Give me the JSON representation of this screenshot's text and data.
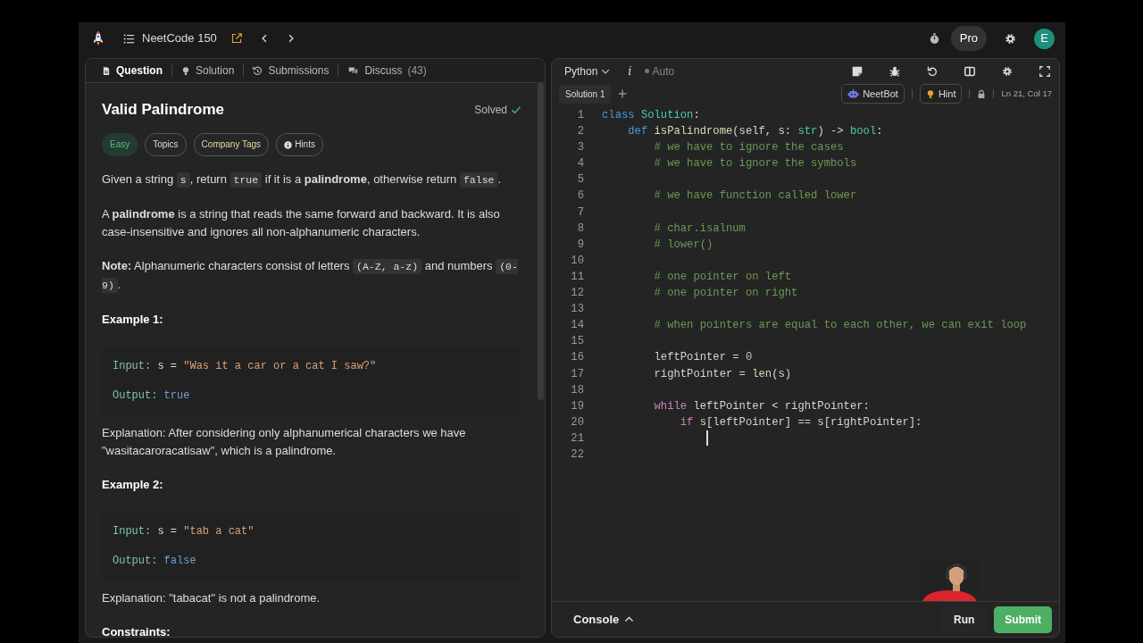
{
  "top_bar": {
    "problem_list": "NeetCode 150",
    "pro": "Pro",
    "avatar": "E"
  },
  "question_panel": {
    "tabs": [
      {
        "label": "Question",
        "selected": true
      },
      {
        "label": "Solution",
        "selected": false
      },
      {
        "label": "Submissions",
        "selected": false
      },
      {
        "label": "Discuss",
        "count": "(43)",
        "selected": false
      }
    ],
    "title": "Valid Palindrome",
    "status": "Solved",
    "tags": [
      {
        "label": "Easy",
        "kind": "difficulty"
      },
      {
        "label": "Topics",
        "kind": "plain"
      },
      {
        "label": "Company Tags",
        "kind": "company"
      },
      {
        "label": "Hints",
        "kind": "hint"
      }
    ],
    "blocks": [
      {
        "kind": "paragraph",
        "parts": [
          {
            "kind": "text",
            "text": "Given a string "
          },
          {
            "kind": "code",
            "text": "s"
          },
          {
            "kind": "text",
            "text": ", return "
          },
          {
            "kind": "code",
            "text": "true"
          },
          {
            "kind": "text",
            "text": " if it is a **palindrome**, otherwise return "
          },
          {
            "kind": "code",
            "text": "false"
          },
          {
            "kind": "text",
            "text": "."
          }
        ]
      },
      {
        "kind": "paragraph",
        "parts": [
          {
            "kind": "text",
            "text": "A **palindrome** is a string that reads the same forward and backward. It is also case-insensitive and ignores all non-alphanumeric characters."
          }
        ]
      },
      {
        "kind": "paragraph",
        "parts": [
          {
            "kind": "text",
            "text": "**Note:** Alphanumeric characters consist of letters "
          },
          {
            "kind": "code",
            "text": "(A-Z, a-z)"
          },
          {
            "kind": "text",
            "text": " and numbers "
          },
          {
            "kind": "code",
            "text": "(0-9)"
          },
          {
            "kind": "text",
            "text": "."
          }
        ]
      },
      {
        "kind": "heading",
        "text": "Example 1:"
      },
      {
        "kind": "example",
        "lines": [
          [
            {
              "kind": "label",
              "text": "Input:"
            },
            {
              "kind": "plain",
              "text": " s = "
            },
            {
              "kind": "string",
              "text": "\"Was it a car or a cat I saw?\""
            }
          ],
          [
            {
              "kind": "label",
              "text": "Output:"
            },
            {
              "kind": "value",
              "text": "true"
            }
          ]
        ]
      },
      {
        "kind": "paragraph",
        "parts": [
          {
            "kind": "text",
            "text": "Explanation: After considering only alphanumerical characters we have \"wasitacaroracatisaw\", which is a palindrome."
          }
        ]
      },
      {
        "kind": "heading",
        "text": "Example 2:"
      },
      {
        "kind": "example",
        "lines": [
          [
            {
              "kind": "label",
              "text": "Input:"
            },
            {
              "kind": "plain",
              "text": " s = "
            },
            {
              "kind": "string",
              "text": "\"tab a cat\""
            }
          ],
          [
            {
              "kind": "label",
              "text": "Output:"
            },
            {
              "kind": "value",
              "text": "false"
            }
          ]
        ]
      },
      {
        "kind": "paragraph",
        "parts": [
          {
            "kind": "text",
            "text": "Explanation: \"tabacat\" is not a palindrome."
          }
        ]
      },
      {
        "kind": "heading",
        "text": "Constraints:"
      }
    ]
  },
  "editor": {
    "language": "Python",
    "info": "i",
    "mode": "Auto",
    "solution_tabs": [
      {
        "label": "Solution 1",
        "selected": true
      }
    ],
    "neetbot": "NeetBot",
    "hint": "Hint",
    "position": "Ln 21, Col 17",
    "lines": [
      {
        "number": "1",
        "cursor": false,
        "tokens": [
          {
            "kind": "keyword",
            "text": "class "
          },
          {
            "kind": "class",
            "text": "Solution"
          },
          {
            "kind": "plain",
            "text": ":"
          }
        ]
      },
      {
        "number": "2",
        "cursor": false,
        "tokens": [
          {
            "kind": "keyword",
            "text": "    def "
          },
          {
            "kind": "function",
            "text": "isPalindrome"
          },
          {
            "kind": "plain",
            "text": "(self, s: "
          },
          {
            "kind": "type",
            "text": "str"
          },
          {
            "kind": "plain",
            "text": ") -> "
          },
          {
            "kind": "type",
            "text": "bool"
          },
          {
            "kind": "plain",
            "text": ":"
          }
        ]
      },
      {
        "number": "3",
        "cursor": false,
        "tokens": [
          {
            "kind": "comment",
            "text": "        # we have to ignore the cases"
          }
        ]
      },
      {
        "number": "4",
        "cursor": false,
        "tokens": [
          {
            "kind": "comment",
            "text": "        # we have to ignore the symbols"
          }
        ]
      },
      {
        "number": "5",
        "cursor": false
      },
      {
        "number": "6",
        "cursor": false,
        "tokens": [
          {
            "kind": "comment",
            "text": "        # we have function called lower"
          }
        ]
      },
      {
        "number": "7",
        "cursor": false
      },
      {
        "number": "8",
        "cursor": false,
        "tokens": [
          {
            "kind": "comment",
            "text": "        # char.isalnum"
          }
        ]
      },
      {
        "number": "9",
        "cursor": false,
        "tokens": [
          {
            "kind": "comment",
            "text": "        # lower()"
          }
        ]
      },
      {
        "number": "10",
        "cursor": false
      },
      {
        "number": "11",
        "cursor": false,
        "tokens": [
          {
            "kind": "comment",
            "text": "        # one pointer on left"
          }
        ]
      },
      {
        "number": "12",
        "cursor": false,
        "tokens": [
          {
            "kind": "comment",
            "text": "        # one pointer on right"
          }
        ]
      },
      {
        "number": "13",
        "cursor": false
      },
      {
        "number": "14",
        "cursor": false,
        "tokens": [
          {
            "kind": "comment",
            "text": "        # when pointers are equal to each other, we can exit loop"
          }
        ]
      },
      {
        "number": "15",
        "cursor": false
      },
      {
        "number": "16",
        "cursor": false,
        "tokens": [
          {
            "kind": "plain",
            "text": "        leftPointer = "
          },
          {
            "kind": "number",
            "text": "0"
          }
        ]
      },
      {
        "number": "17",
        "cursor": false,
        "tokens": [
          {
            "kind": "plain",
            "text": "        rightPointer = "
          },
          {
            "kind": "function",
            "text": "len"
          },
          {
            "kind": "plain",
            "text": "(s)"
          }
        ]
      },
      {
        "number": "18",
        "cursor": false
      },
      {
        "number": "19",
        "cursor": false,
        "tokens": [
          {
            "kind": "control",
            "text": "        while"
          },
          {
            "kind": "plain",
            "text": " leftPointer < rightPointer:"
          }
        ]
      },
      {
        "number": "20",
        "cursor": false,
        "tokens": [
          {
            "kind": "control",
            "text": "            if"
          },
          {
            "kind": "plain",
            "text": " s[leftPointer] == s[rightPointer]:"
          }
        ]
      },
      {
        "number": "21",
        "cursor": true
      },
      {
        "number": "22",
        "cursor": false
      }
    ],
    "console": "Console",
    "run": "Run",
    "submit": "Submit"
  }
}
